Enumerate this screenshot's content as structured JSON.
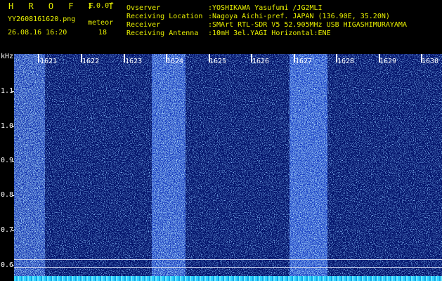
{
  "header": {
    "app_title": "H R O F F T",
    "version": "1.0.0f",
    "filename": "YY2608161620.png",
    "meteor_label": "meteor",
    "datetime": "26.08.16 16:20",
    "meteor_count": "18",
    "info": [
      {
        "key": "Ovserver",
        "value": ":YOSHIKAWA Yasufumi /JG2MLI"
      },
      {
        "key": "Receiving Location",
        "value": ":Nagoya Aichi-pref. JAPAN (136.90E, 35.20N)"
      },
      {
        "key": "Receiver",
        "value": ":SMArt RTL-SDR V5 52.905MHz USB HIGASHIMURAYAMA"
      },
      {
        "key": "Receiving Antenna",
        "value": ":10mH 3el.YAGI Horizontal:ENE"
      }
    ]
  },
  "spectrogram": {
    "y_unit": "kHz",
    "y_labels": [
      "1.1",
      "1.0",
      "0.9",
      "0.8",
      "0.7",
      "0.6"
    ],
    "time_labels": [
      "1621",
      "1622",
      "1623",
      "1624",
      "1625",
      "1626",
      "1627",
      "1628",
      "1629",
      "1630"
    ],
    "colors": {
      "background": "#03136b",
      "band": "#0a2bb0",
      "noise": "#2f7cff",
      "baseline": "#30d0ff"
    }
  }
}
